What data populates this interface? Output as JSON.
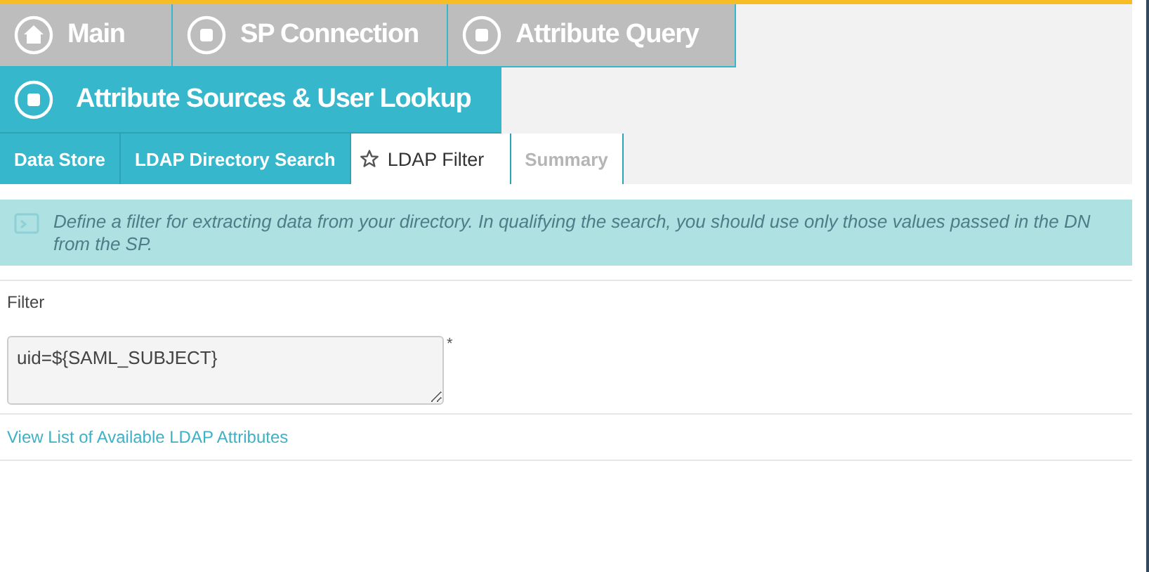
{
  "steps": [
    {
      "label": "Main",
      "kind": "home",
      "selected": false
    },
    {
      "label": "SP Connection",
      "kind": "step",
      "selected": false
    },
    {
      "label": "Attribute Query",
      "kind": "step",
      "selected": false
    },
    {
      "label": "Attribute Sources & User Lookup",
      "kind": "step",
      "selected": true
    }
  ],
  "sub_tabs": [
    {
      "label": "Data Store",
      "selected": false,
      "disabled": false
    },
    {
      "label": "LDAP Directory Search",
      "selected": false,
      "disabled": false
    },
    {
      "label": "LDAP Filter",
      "selected": true,
      "disabled": false
    },
    {
      "label": "Summary",
      "selected": false,
      "disabled": true
    }
  ],
  "info": "Define a filter for extracting data from your directory. In qualifying the search, you should use only those values passed in the DN from the SP.",
  "filter": {
    "label": "Filter",
    "value": "uid=${SAML_SUBJECT}",
    "required_mark": "*"
  },
  "link": "View List of Available LDAP Attributes"
}
